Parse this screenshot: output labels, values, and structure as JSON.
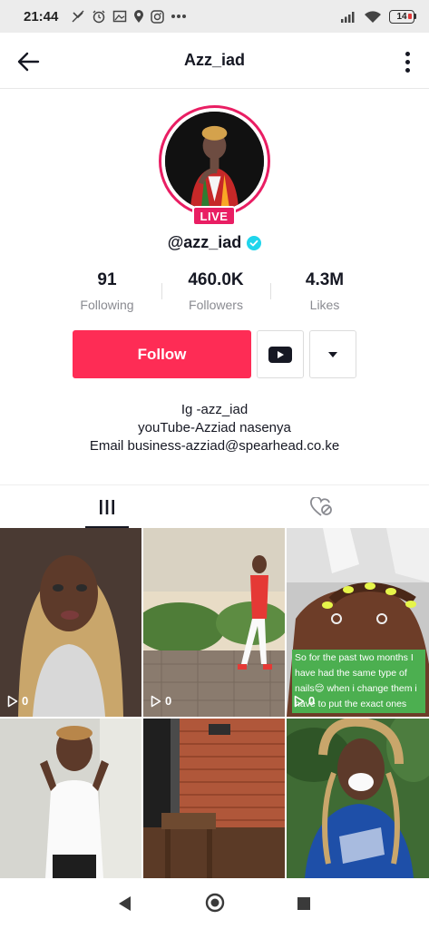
{
  "status_bar": {
    "time": "21:44",
    "battery": "14",
    "icons": [
      "missed-call-icon",
      "alarm-icon",
      "gallery-icon",
      "location-icon",
      "instagram-icon",
      "more-dots-icon",
      "signal-icon",
      "wifi-icon",
      "battery-icon"
    ]
  },
  "header": {
    "title": "Azz_iad"
  },
  "profile": {
    "live_label": "LIVE",
    "handle": "@azz_iad",
    "verified": true
  },
  "stats": [
    {
      "value": "91",
      "label": "Following"
    },
    {
      "value": "460.0K",
      "label": "Followers"
    },
    {
      "value": "4.3M",
      "label": "Likes"
    }
  ],
  "actions": {
    "follow_label": "Follow"
  },
  "bio": {
    "lines": [
      "Ig -azz_iad",
      "youTube-Azziad nasenya",
      "Email business-azziad@spearhead.co.ke"
    ]
  },
  "tabs": [
    {
      "icon": "grid-icon",
      "active": true
    },
    {
      "icon": "liked-heart-icon",
      "active": false
    }
  ],
  "videos": [
    {
      "plays": "0"
    },
    {
      "plays": "0"
    },
    {
      "plays": "0",
      "caption": "So for the past two months I have had the same type of nails😌 when i change them i have to put the exact ones"
    },
    {
      "plays": ""
    },
    {
      "plays": ""
    },
    {
      "plays": ""
    }
  ],
  "colors": {
    "accent": "#fe2c55",
    "live": "#e91e63",
    "verified": "#20d5ec"
  }
}
